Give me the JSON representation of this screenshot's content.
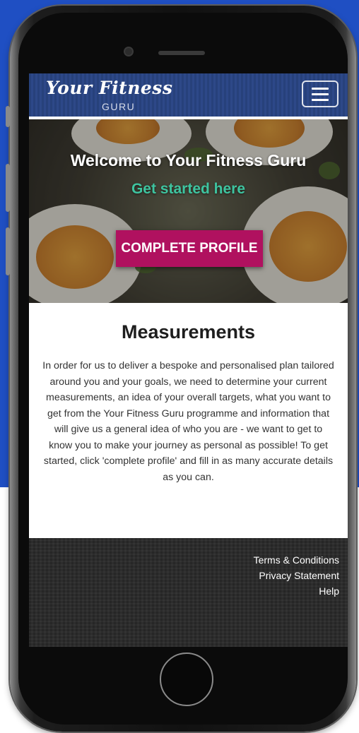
{
  "navbar": {
    "logo_main": "Your Fitness",
    "logo_sub": "GURU",
    "menu_icon": "hamburger-menu-icon"
  },
  "hero": {
    "title": "Welcome to Your Fitness Guru",
    "subtitle": "Get started here",
    "cta_label": "COMPLETE PROFILE"
  },
  "content": {
    "heading": "Measurements",
    "body": "In order for us to deliver a bespoke and personalised plan tailored around you and your goals, we need to determine your current measurements, an idea of your overall targets, what you want to get from the Your Fitness Guru programme and information that will give us a general idea of who you are - we want to get to know you to make your journey as personal as possible! To get started, click 'complete profile' and fill in as many accurate details as you can."
  },
  "footer": {
    "links": [
      "Terms & Conditions",
      "Privacy Statement",
      "Help"
    ]
  },
  "colors": {
    "background_blue": "#1f4fc3",
    "navbar": "#2a4583",
    "accent_teal": "#3ec4a0",
    "cta": "#b0115f",
    "footer": "#292929"
  }
}
